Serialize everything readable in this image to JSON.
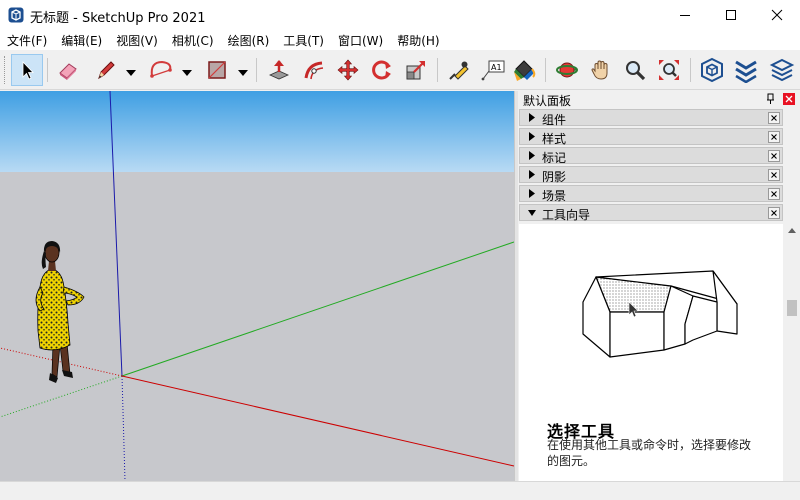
{
  "window": {
    "title": "无标题 - SketchUp Pro 2021",
    "app_icon": "sketchup-logo-icon",
    "controls": [
      "minimize-icon",
      "maximize-icon",
      "close-icon"
    ]
  },
  "menu": {
    "items": [
      {
        "label": "文件(F)"
      },
      {
        "label": "编辑(E)"
      },
      {
        "label": "视图(V)"
      },
      {
        "label": "相机(C)"
      },
      {
        "label": "绘图(R)"
      },
      {
        "label": "工具(T)"
      },
      {
        "label": "窗口(W)"
      },
      {
        "label": "帮助(H)"
      }
    ]
  },
  "toolbar": {
    "tools": [
      {
        "name": "select-tool",
        "icon": "arrow-cursor-icon",
        "active": true
      },
      {
        "name": "eraser-tool",
        "icon": "eraser-icon"
      },
      {
        "name": "line-tool",
        "icon": "pencil-icon",
        "dropdown": true
      },
      {
        "name": "arc-tool",
        "icon": "arc-icon",
        "dropdown": true
      },
      {
        "name": "rectangle-tool",
        "icon": "rectangle-icon",
        "dropdown": true
      },
      {
        "name": "push-pull-tool",
        "icon": "push-pull-icon"
      },
      {
        "name": "offset-tool",
        "icon": "offset-icon"
      },
      {
        "name": "move-tool",
        "icon": "move-icon"
      },
      {
        "name": "rotate-tool",
        "icon": "rotate-icon"
      },
      {
        "name": "scale-tool",
        "icon": "scale-icon"
      },
      {
        "name": "tape-measure-tool",
        "icon": "tape-measure-icon"
      },
      {
        "name": "text-tool",
        "icon": "text-label-icon",
        "text": "A1"
      },
      {
        "name": "paint-bucket-tool",
        "icon": "paint-bucket-icon"
      },
      {
        "name": "orbit-tool",
        "icon": "orbit-icon"
      },
      {
        "name": "pan-tool",
        "icon": "hand-icon"
      },
      {
        "name": "zoom-tool",
        "icon": "magnifier-icon"
      },
      {
        "name": "zoom-extents-tool",
        "icon": "zoom-extents-icon"
      },
      {
        "name": "warehouse-tool",
        "icon": "3d-warehouse-icon"
      },
      {
        "name": "extension-warehouse-tool",
        "icon": "extension-warehouse-icon"
      },
      {
        "name": "layout-tool",
        "icon": "layers-stack-icon"
      }
    ]
  },
  "colors": {
    "sky_top": "#3f9fe3",
    "sky_bottom": "#b8daf4",
    "ground": "#c7c8cc",
    "axis_red": "#cc0000",
    "axis_green": "#22aa22",
    "axis_blue": "#1a1aaa",
    "accent_close": "#e81123"
  },
  "tray": {
    "title": "默认面板",
    "panels": [
      {
        "label": "组件",
        "expanded": false
      },
      {
        "label": "样式",
        "expanded": false
      },
      {
        "label": "标记",
        "expanded": false
      },
      {
        "label": "阴影",
        "expanded": false
      },
      {
        "label": "场景",
        "expanded": false
      },
      {
        "label": "工具向导",
        "expanded": true
      }
    ],
    "instructor": {
      "title": "选择工具",
      "description": "在使用其他工具或命令时，选择要修改的图元。"
    }
  }
}
